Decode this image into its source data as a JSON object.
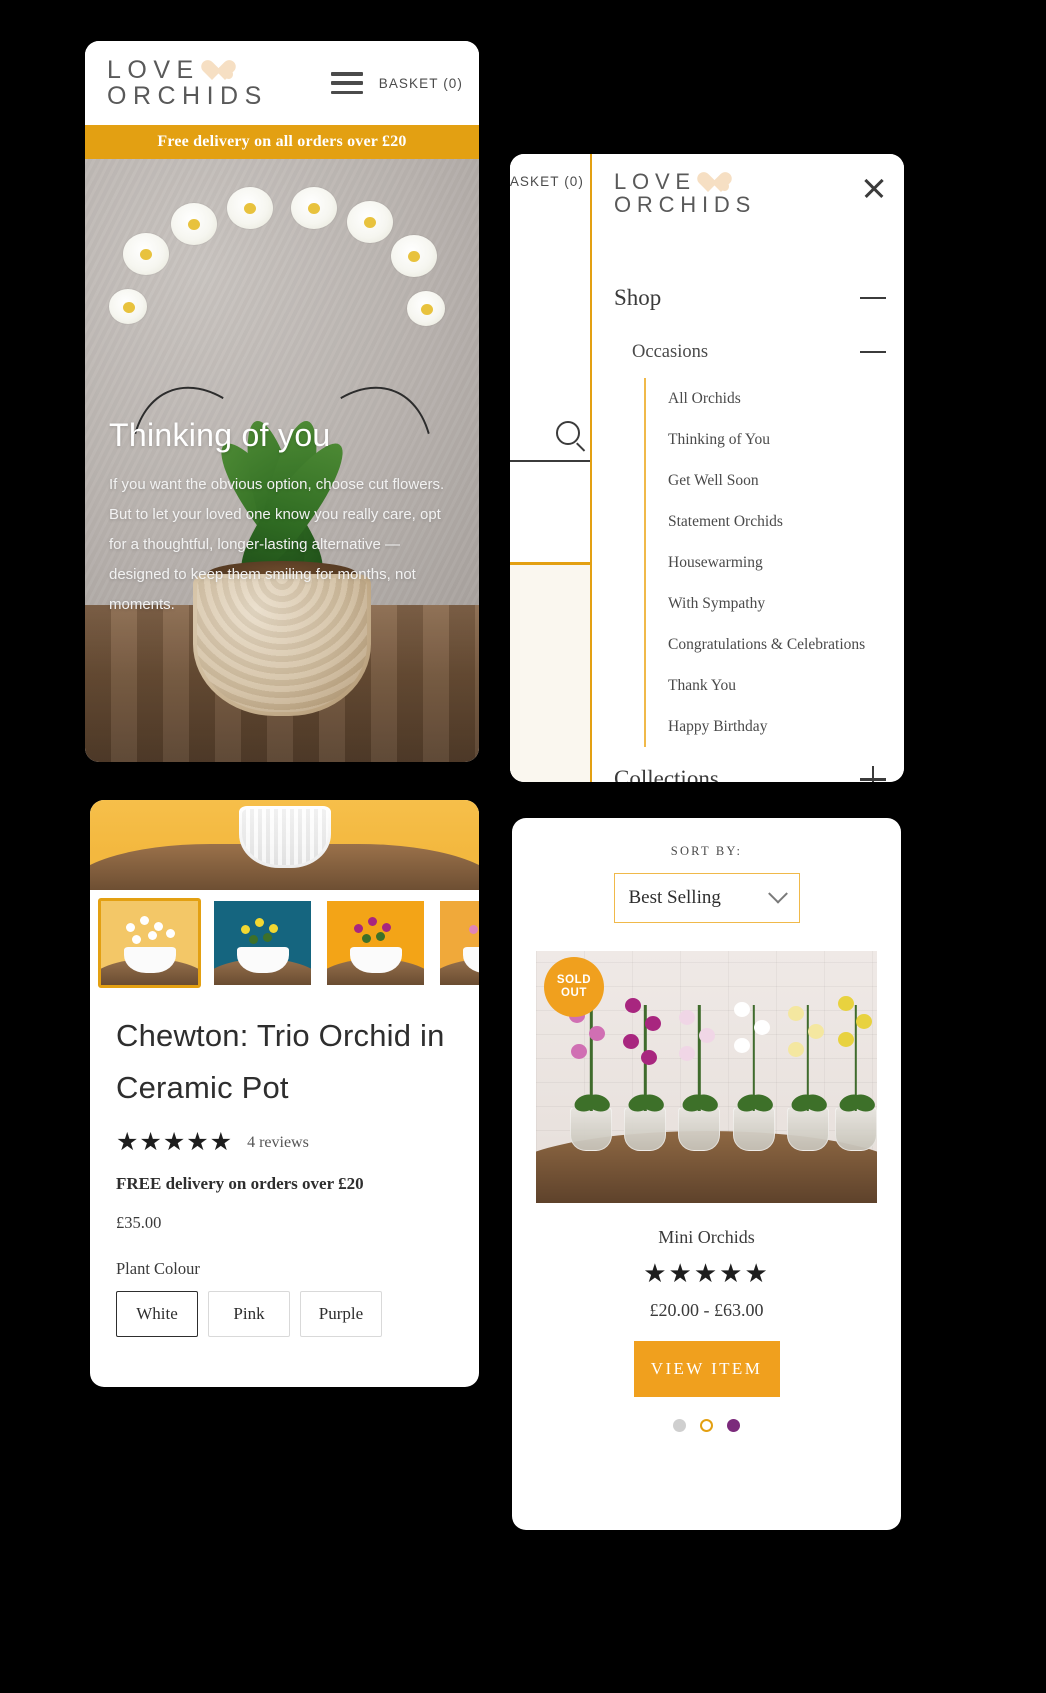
{
  "brand": {
    "line1": "LOVE",
    "line2": "ORCHIDS",
    "heart_icon": "heart-icon"
  },
  "home": {
    "header": {
      "basket_label": "BASKET (0)",
      "menu_icon": "hamburger-icon"
    },
    "promo": "Free delivery on all orders over £20",
    "hero": {
      "title": "Thinking of you",
      "copy": "If you want the obvious option, choose cut flowers. But to let your loved one know you really care, opt for a thoughtful, longer-lasting alternative — designed to keep them smiling for months, not moments."
    }
  },
  "menu": {
    "behind": {
      "basket_label": "ASKET (0)",
      "search_icon": "search-icon"
    },
    "close_icon": "close-icon",
    "sections": [
      {
        "label": "Shop",
        "toggle": "minus-icon"
      },
      {
        "label": "Occasions",
        "toggle": "minus-icon"
      }
    ],
    "occasions": [
      "All Orchids",
      "Thinking of You",
      "Get Well Soon",
      "Statement Orchids",
      "Housewarming",
      "With Sympathy",
      "Congratulations & Celebrations",
      "Thank You",
      "Happy Birthday"
    ],
    "collections": {
      "label": "Collections",
      "toggle": "plus-icon"
    }
  },
  "product": {
    "title": "Chewton: Trio Orchid in Ceramic Pot",
    "stars": "★★★★★",
    "reviews": "4 reviews",
    "free_delivery": "FREE delivery on orders over £20",
    "price": "£35.00",
    "option_label": "Plant Colour",
    "options": [
      "White",
      "Pink",
      "Purple"
    ],
    "selected_option": "White",
    "thumbnails": [
      {
        "name": "thumb-white-orchid",
        "bg": "#f3c767",
        "flower": "#ffffff",
        "active": true
      },
      {
        "name": "thumb-yellow-orchid",
        "bg": "#15657f",
        "flower": "#f2d832",
        "active": false
      },
      {
        "name": "thumb-purple-orchid",
        "bg": "#f3a417",
        "flower": "#a8267f",
        "active": false
      },
      {
        "name": "thumb-pink-orchid",
        "bg": "#f0a93a",
        "flower": "#e084b8",
        "active": false
      }
    ]
  },
  "collection": {
    "sort_label": "SORT BY:",
    "sort_value": "Best Selling",
    "chevron_icon": "chevron-down-icon",
    "badge": {
      "line1": "SOLD",
      "line2": "OUT"
    },
    "card": {
      "name": "Mini Orchids",
      "stars": "★★★★★",
      "price": "£20.00 - £63.00",
      "cta": "VIEW ITEM"
    },
    "dots": [
      {
        "name": "carousel-dot-1",
        "style": "grey"
      },
      {
        "name": "carousel-dot-2",
        "style": "ring"
      },
      {
        "name": "carousel-dot-3",
        "style": "purple"
      }
    ],
    "orchid_colors": [
      "#d06fb3",
      "#a8267f",
      "#f0d6e6",
      "#ffffff",
      "#f4e7a0",
      "#e8d23f"
    ]
  },
  "colors": {
    "accent_orange": "#e3a012",
    "button_orange": "#f0a01e",
    "heart_cream": "#f6dfc3",
    "text_dark": "#2e2e2e"
  }
}
